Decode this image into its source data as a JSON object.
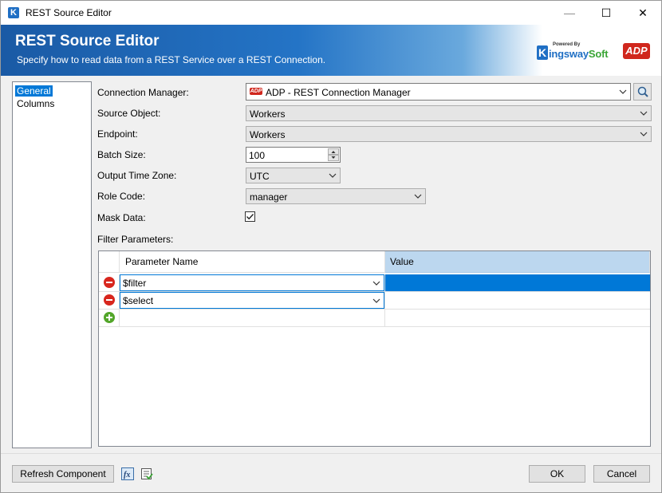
{
  "window": {
    "title": "REST Source Editor",
    "minimize": "—",
    "maximize": "☐",
    "close": "✕"
  },
  "banner": {
    "title": "REST Source Editor",
    "subtitle": "Specify how to read data from a REST Service over a REST Connection.",
    "powered_by": "Powered By",
    "brand_k": "K",
    "brand_name_a": "ingsway",
    "brand_name_b": "Soft",
    "adp": "ADP"
  },
  "nav": {
    "items": [
      {
        "label": "General",
        "selected": true
      },
      {
        "label": "Columns",
        "selected": false
      }
    ]
  },
  "form": {
    "connection_manager": {
      "label": "Connection Manager:",
      "value": "ADP - REST Connection Manager"
    },
    "source_object": {
      "label": "Source Object:",
      "value": "Workers"
    },
    "endpoint": {
      "label": "Endpoint:",
      "value": "Workers"
    },
    "batch_size": {
      "label": "Batch Size:",
      "value": "100"
    },
    "output_time_zone": {
      "label": "Output Time Zone:",
      "value": "UTC"
    },
    "role_code": {
      "label": "Role Code:",
      "value": "manager"
    },
    "mask_data": {
      "label": "Mask Data:",
      "checked": true
    },
    "filter_parameters": {
      "label": "Filter Parameters:"
    }
  },
  "grid": {
    "columns": [
      "Parameter Name",
      "Value"
    ],
    "rows": [
      {
        "name": "$filter",
        "value": "",
        "selected": true
      },
      {
        "name": "$select",
        "value": "",
        "selected": false
      }
    ]
  },
  "footer": {
    "refresh_label": "Refresh Component",
    "ok_label": "OK",
    "cancel_label": "Cancel"
  },
  "colors": {
    "accent": "#0078d7",
    "banner": "#2474c6",
    "remove": "#d8261d",
    "add": "#53a62a",
    "adp": "#d0271d"
  }
}
